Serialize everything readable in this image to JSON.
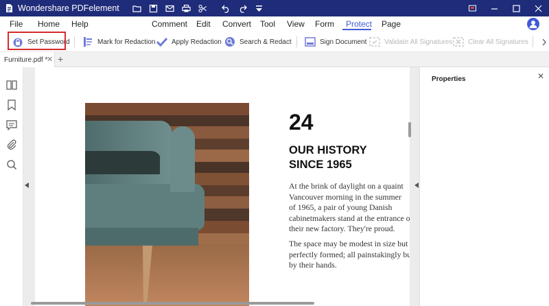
{
  "app": {
    "title": "Wondershare PDFelement"
  },
  "menu": [
    {
      "label": "File"
    },
    {
      "label": "Home"
    },
    {
      "label": "Help"
    },
    {
      "label": "Comment"
    },
    {
      "label": "Edit"
    },
    {
      "label": "Convert"
    },
    {
      "label": "Tool"
    },
    {
      "label": "View"
    },
    {
      "label": "Form"
    },
    {
      "label": "Protect"
    },
    {
      "label": "Page"
    }
  ],
  "active_menu": "Protect",
  "ribbon": {
    "set_password": "Set Password",
    "mark_for_redaction": "Mark for Redaction",
    "apply_redaction": "Apply Redaction",
    "search_redact": "Search & Redact",
    "sign_document": "Sign Document",
    "validate_all_signatures": "Validate All Signatures",
    "clear_all_signatures": "Clear All Signatures"
  },
  "tab": {
    "name": "Furniture.pdf *"
  },
  "document": {
    "number": "24",
    "heading_line1": "OUR HISTORY",
    "heading_line2": "SINCE 1965",
    "para1": [
      "At the brink of daylight on a quaint",
      "Vancouver morning in the summer",
      "of 1965, a pair of young Danish",
      "cabinetmakers stand at the entrance of",
      "their new factory. They're proud."
    ],
    "para2": [
      "The space may be modest in size but it's",
      "perfectly formed; all painstakingly built",
      "by their hands."
    ]
  },
  "properties": {
    "title": "Properties"
  },
  "colors": {
    "titlebar": "#1f2c7a",
    "accent": "#3f5bd8",
    "highlight": "#d32a2a"
  },
  "icons": {
    "titlebar": [
      "open-folder-icon",
      "save-icon",
      "email-icon",
      "print-icon",
      "scissors-icon",
      "undo-icon",
      "redo-icon",
      "dropdown-icon"
    ],
    "leftbar": [
      "thumbnails-icon",
      "bookmark-icon",
      "comment-icon",
      "attachment-icon",
      "search-icon"
    ]
  }
}
